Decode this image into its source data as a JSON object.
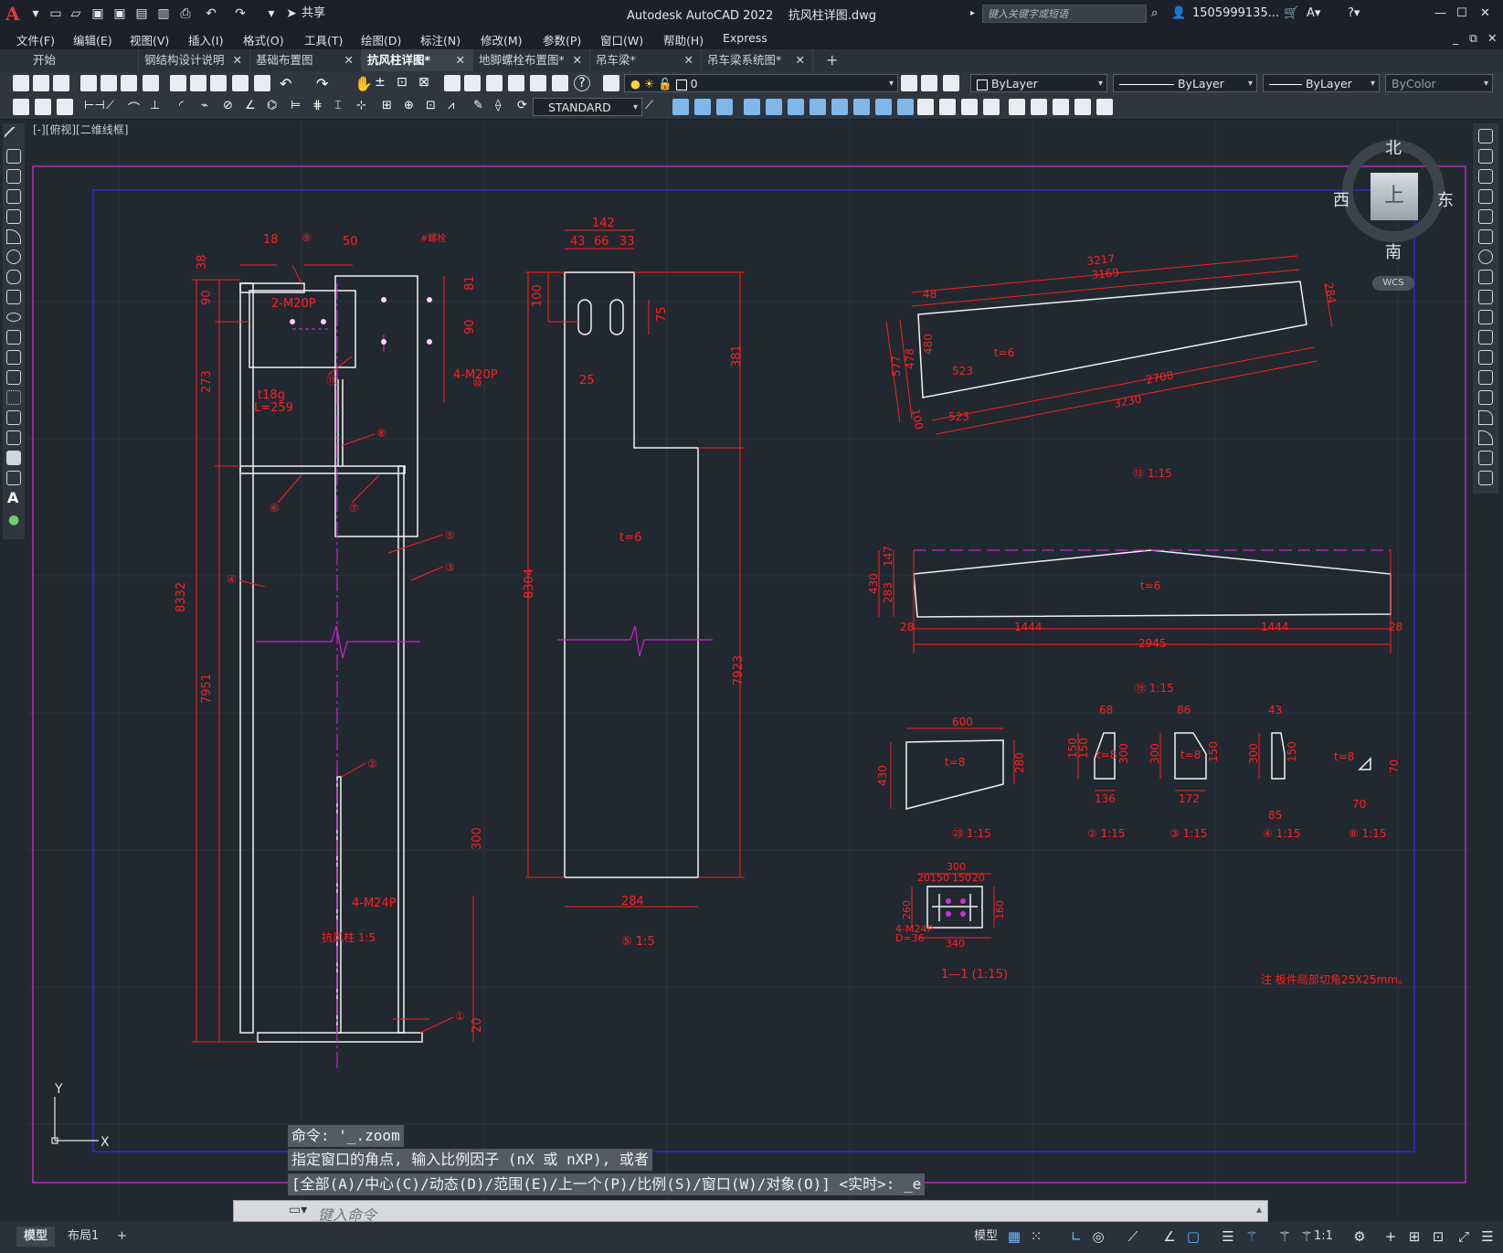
{
  "app": {
    "title": "Autodesk AutoCAD 2022",
    "document": "抗风柱详图.dwg",
    "share": "共享",
    "search_placeholder": "键入关键字或短语",
    "user": "1505999135...",
    "window_controls": [
      "minimize-icon",
      "maximize-icon",
      "close-icon"
    ]
  },
  "menu": [
    "文件(F)",
    "编辑(E)",
    "视图(V)",
    "插入(I)",
    "格式(O)",
    "工具(T)",
    "绘图(D)",
    "标注(N)",
    "修改(M)",
    "参数(P)",
    "窗口(W)",
    "帮助(H)",
    "Express"
  ],
  "tabs": [
    {
      "label": "开始",
      "closable": false,
      "active": false
    },
    {
      "label": "钢结构设计说明",
      "closable": true,
      "active": false
    },
    {
      "label": "基础布置图",
      "closable": true,
      "active": false
    },
    {
      "label": "抗风柱详图*",
      "closable": true,
      "active": true
    },
    {
      "label": "地脚螺栓布置图*",
      "closable": true,
      "active": false
    },
    {
      "label": "吊车梁*",
      "closable": true,
      "active": false
    },
    {
      "label": "吊车梁系统图*",
      "closable": true,
      "active": false
    }
  ],
  "layers": {
    "current_layer": "0",
    "color": "ByLayer",
    "linetype": "ByLayer",
    "lineweight": "ByLayer",
    "plotstyle": "ByColor"
  },
  "textstyle": "STANDARD",
  "viewport_label": "[-][俯视][二维线框]",
  "viewcube": {
    "top": "上",
    "north": "北",
    "south": "南",
    "east": "东",
    "west": "西",
    "wcs": "WCS"
  },
  "drawing": {
    "col_dims": [
      "18",
      "50",
      "#螺栓",
      "38",
      "90",
      "273",
      "8332",
      "7951",
      "81",
      "90",
      "2-M20P",
      "t18g",
      "L=259",
      "4-M20P",
      "4-M24P",
      "300",
      "20"
    ],
    "col_title": "抗风柱 1:5",
    "plate5_dims": [
      "142",
      "43",
      "66",
      "33",
      "100",
      "75",
      "25",
      "381",
      "8304",
      "7923",
      "t=6",
      "284"
    ],
    "plate5_title": "⑤ 1:5",
    "p13_dims": [
      "3217",
      "3169",
      "48",
      "284",
      "577",
      "478",
      "480",
      "523",
      "523",
      "2708",
      "3230",
      "100",
      "t=6"
    ],
    "p13_title": "⑬ 1:15",
    "p19_dims": [
      "430",
      "147",
      "283",
      "28",
      "1444",
      "1444",
      "28",
      "2945",
      "t=6"
    ],
    "p19_title": "⑲ 1:15",
    "small_parts": [
      {
        "title": "㉓ 1:15",
        "dims": [
          "600",
          "430",
          "280",
          "t=8"
        ]
      },
      {
        "title": "② 1:15",
        "dims": [
          "68",
          "150",
          "150",
          "300",
          "136",
          "t=8"
        ]
      },
      {
        "title": "③ 1:15",
        "dims": [
          "86",
          "300",
          "150",
          "172",
          "t=8"
        ]
      },
      {
        "title": "④ 1:15",
        "dims": [
          "43",
          "300",
          "150",
          "85"
        ]
      },
      {
        "title": "⑧ 1:15",
        "dims": [
          "t=8",
          "70",
          "70"
        ]
      }
    ],
    "section_title": "1—1 (1:15)",
    "section_dims": [
      "300",
      "20",
      "150",
      "150",
      "20",
      "340",
      "260",
      "160",
      "4-M24P",
      "D=36"
    ],
    "note": "注  板件局部切角25X25mm。"
  },
  "command": {
    "history": [
      "命令: '_.zoom",
      "指定窗口的角点, 输入比例因子 (nX 或 nXP), 或者",
      "[全部(A)/中心(C)/动态(D)/范围(E)/上一个(P)/比例(S)/窗口(W)/对象(O)] <实时>: _e"
    ],
    "placeholder": "键入命令"
  },
  "status": {
    "layout_tabs": [
      "模型",
      "布局1"
    ],
    "model_label": "模型",
    "scale": "1:1"
  }
}
